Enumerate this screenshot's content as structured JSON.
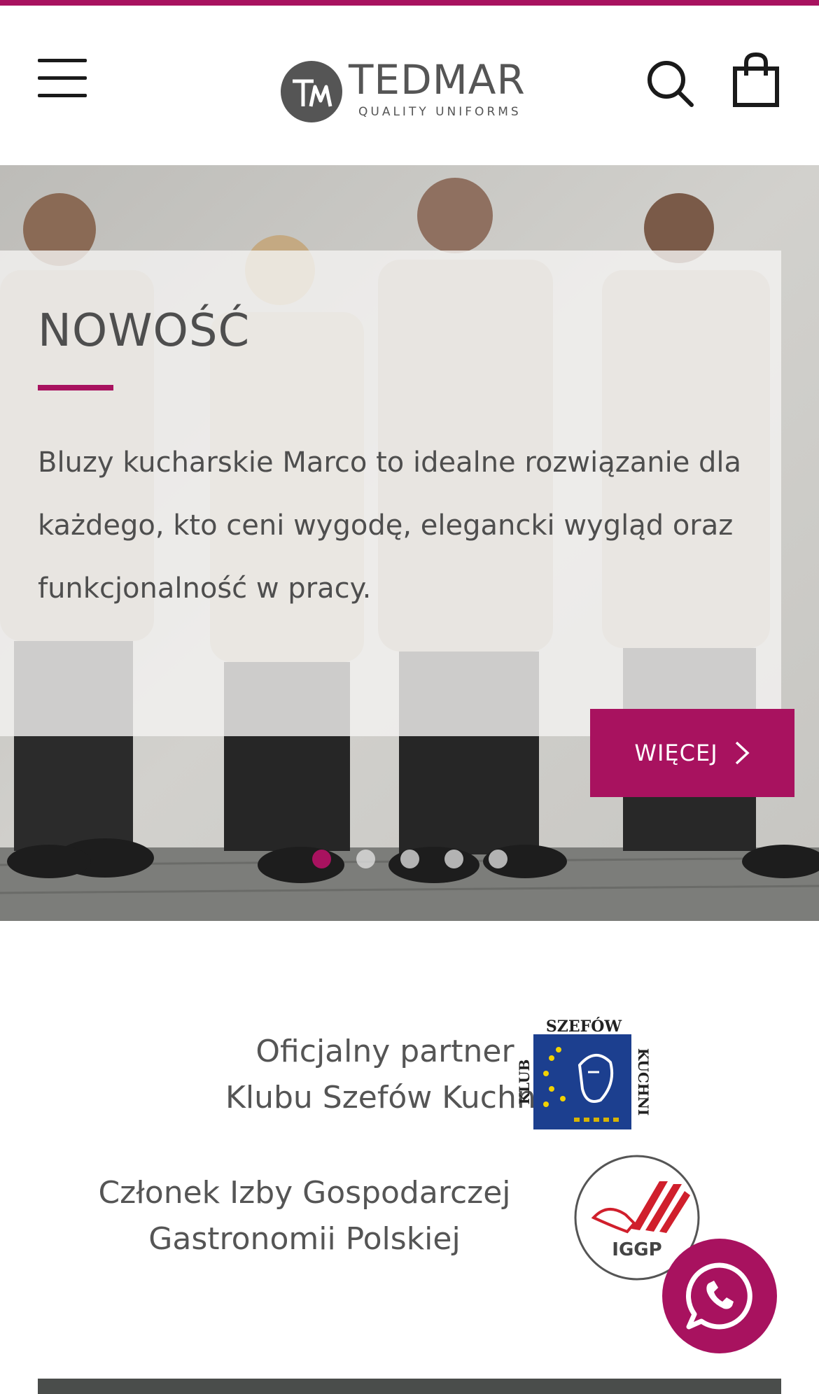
{
  "colors": {
    "accent": "#a8125f",
    "text": "#555555",
    "overlay": "#f3f2f0"
  },
  "header": {
    "logo_name": "TEDMAR",
    "logo_tagline": "QUALITY UNIFORMS",
    "icons": {
      "menu": "hamburger-menu-icon",
      "search": "search-icon",
      "cart": "shopping-bag-icon"
    }
  },
  "hero": {
    "title": "NOWOŚĆ",
    "text": "Bluzy kucharskie Marco to idealne rozwiązanie dla każdego, kto ceni wygodę, elegancki wygląd oraz funkcjonalność w pracy.",
    "button_label": "WIĘCEJ",
    "slides": {
      "count": 5,
      "active": 1
    }
  },
  "partners": {
    "ksk_line1": "Oficjalny partner",
    "ksk_line2": "Klubu Szefów Kuchni",
    "ksk_logo_text": "KLUB SZEFÓW KUCHNI",
    "iggp_line1": "Członek Izby Gospodarczej",
    "iggp_line2": "Gastronomii Polskiej",
    "iggp_logo_text": "IGGP"
  },
  "chat": {
    "icon": "whatsapp-icon"
  }
}
